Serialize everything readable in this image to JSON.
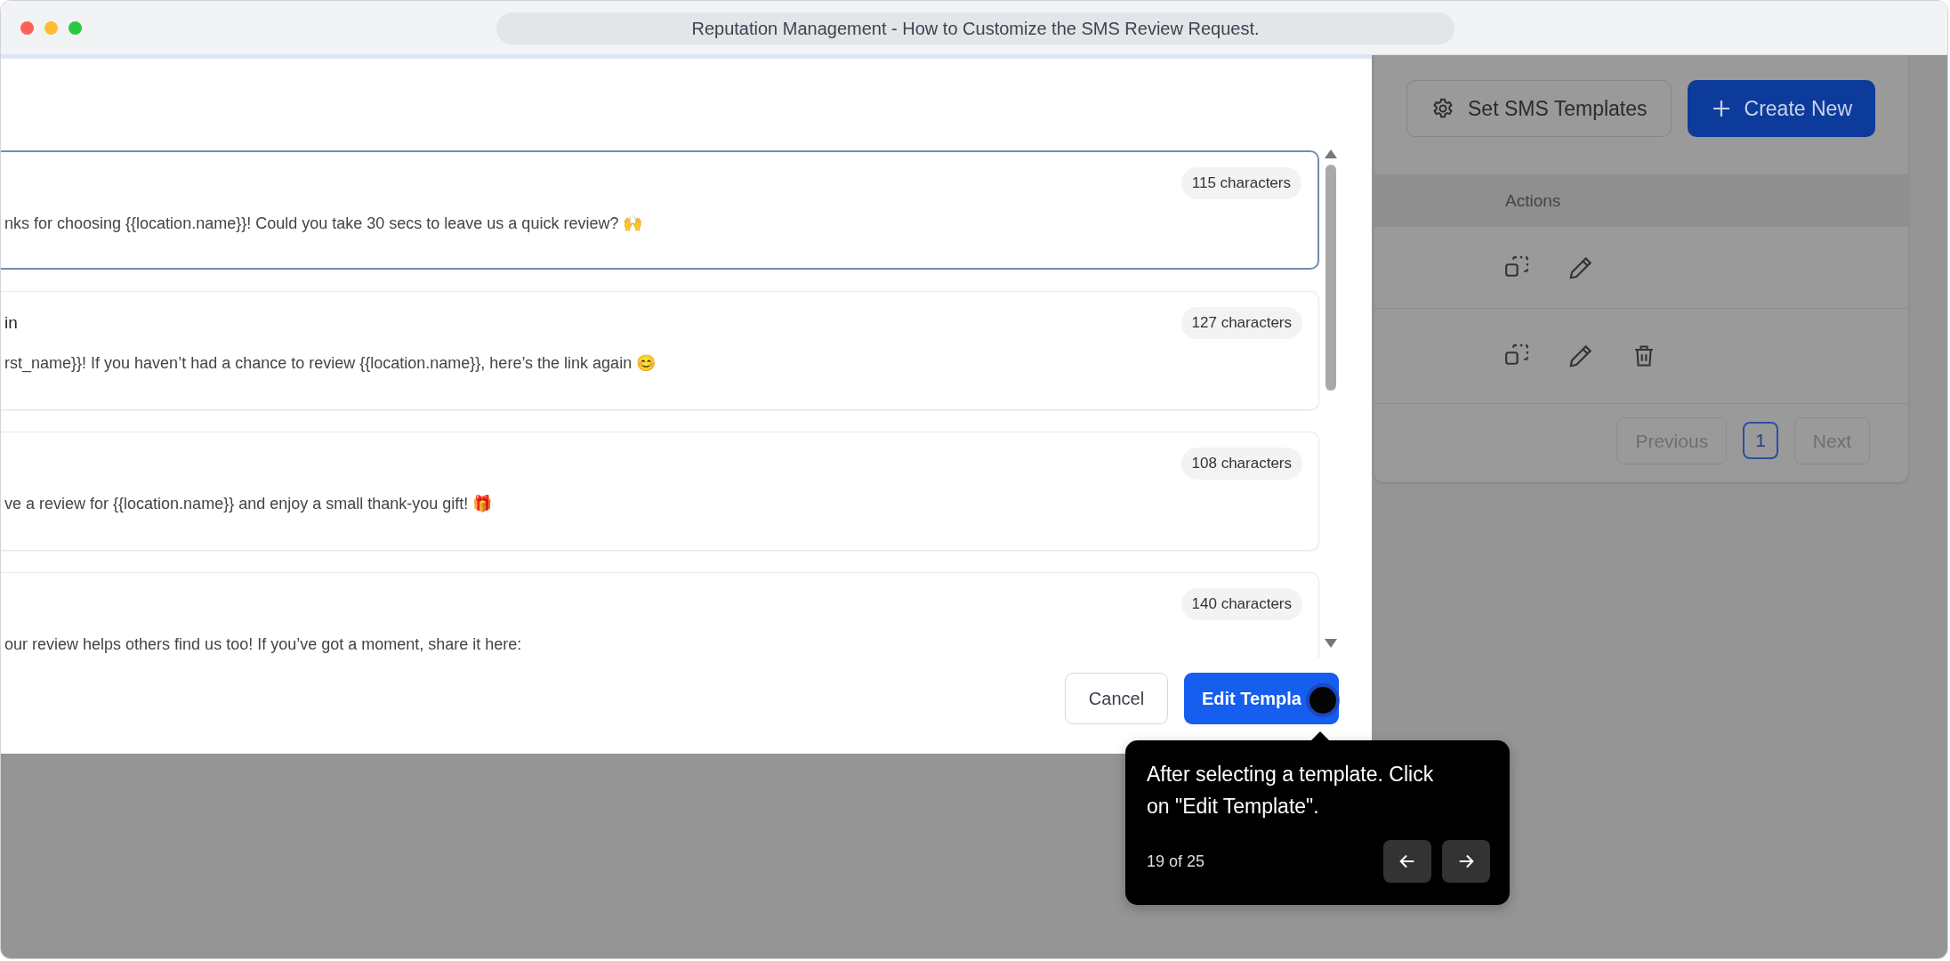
{
  "window": {
    "title": "Reputation Management - How to Customize the SMS Review Request."
  },
  "modal": {
    "templates": [
      {
        "body": "nks for choosing {{location.name}}! Could you take 30 secs to leave us a quick review? 🙌",
        "count": "115 characters",
        "selected": true
      },
      {
        "title": "in",
        "body": "rst_name}}! If you haven’t had a chance to review {{location.name}}, here’s the link again 😊",
        "count": "127 characters",
        "selected": false
      },
      {
        "body": "ve a review for {{location.name}} and enjoy a small thank-you gift! 🎁",
        "count": "108 characters",
        "selected": false
      },
      {
        "body": "our review helps others find us too! If you’ve got a moment, share it here:",
        "count": "140 characters",
        "selected": false
      }
    ],
    "cancel": "Cancel",
    "confirm": "Edit Templa"
  },
  "background": {
    "buttons": [
      {
        "kind": "settings",
        "label": "Set SMS Templates"
      },
      {
        "kind": "create",
        "label": "Create New"
      }
    ],
    "table": {
      "columns": [
        "Actions"
      ],
      "rows": [
        {
          "actions": [
            {
              "kind": "duplicate"
            },
            {
              "kind": "edit"
            }
          ]
        },
        {
          "actions": [
            {
              "kind": "duplicate"
            },
            {
              "kind": "edit"
            },
            {
              "kind": "delete"
            }
          ]
        }
      ]
    },
    "pagination": {
      "previous": "Previous",
      "pages": [
        {
          "label": "1",
          "selected": true
        }
      ],
      "next": "Next"
    }
  },
  "tooltip": {
    "text": "After selecting a template. Click on \"Edit Template\".",
    "step": "19 of 25"
  }
}
